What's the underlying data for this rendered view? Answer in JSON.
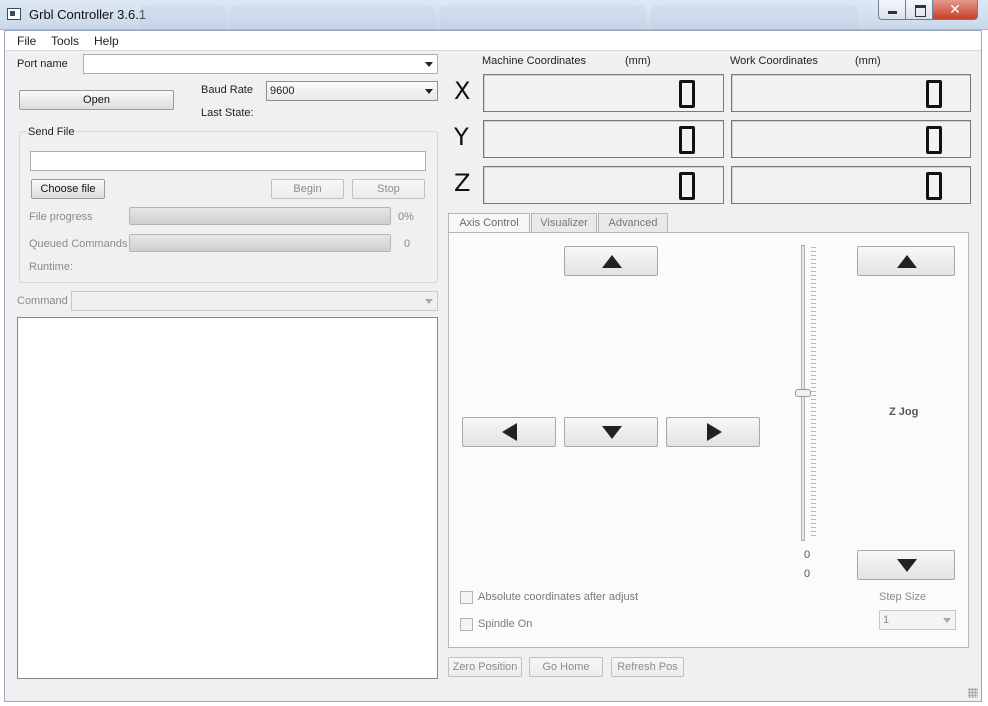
{
  "window": {
    "title": "Grbl Controller 3.6.1",
    "close_glyph": "✕"
  },
  "menu": [
    "File",
    "Tools",
    "Help"
  ],
  "connection": {
    "port_label": "Port name",
    "port_value": "",
    "open_button": "Open",
    "baud_label": "Baud Rate",
    "baud_value": "9600",
    "last_state_label": "Last State:"
  },
  "send_file": {
    "group_title": "Send File",
    "file_path": "",
    "choose_button": "Choose file",
    "begin_button": "Begin",
    "stop_button": "Stop",
    "progress_label": "File progress",
    "progress_value": "0%",
    "queued_label": "Queued Commands",
    "queued_value": "0",
    "runtime_label": "Runtime:"
  },
  "command": {
    "label": "Command",
    "value": ""
  },
  "coordinates": {
    "machine_title": "Machine Coordinates",
    "work_title": "Work Coordinates",
    "unit": "(mm)",
    "axes": [
      "X",
      "Y",
      "Z"
    ],
    "machine_values": [
      0,
      0,
      0
    ],
    "work_values": [
      0,
      0,
      0
    ]
  },
  "tabs": [
    "Axis Control",
    "Visualizer",
    "Advanced"
  ],
  "axis_control": {
    "z_jog_label": "Z Jog",
    "slider_min_label": "0",
    "slider_value_label": "0",
    "abs_coords_label": "Absolute coordinates after adjust",
    "abs_coords_checked": false,
    "spindle_label": "Spindle On",
    "spindle_checked": false,
    "step_size_label": "Step Size",
    "step_size_value": "1"
  },
  "bottom_buttons": {
    "zero_position": "Zero Position",
    "go_home": "Go Home",
    "refresh_pos": "Refresh Pos"
  },
  "icons": {
    "app": "app-icon",
    "jog_up": "arrow-up-icon",
    "jog_down": "arrow-down-icon",
    "jog_left": "arrow-left-icon",
    "jog_right": "arrow-right-icon"
  }
}
